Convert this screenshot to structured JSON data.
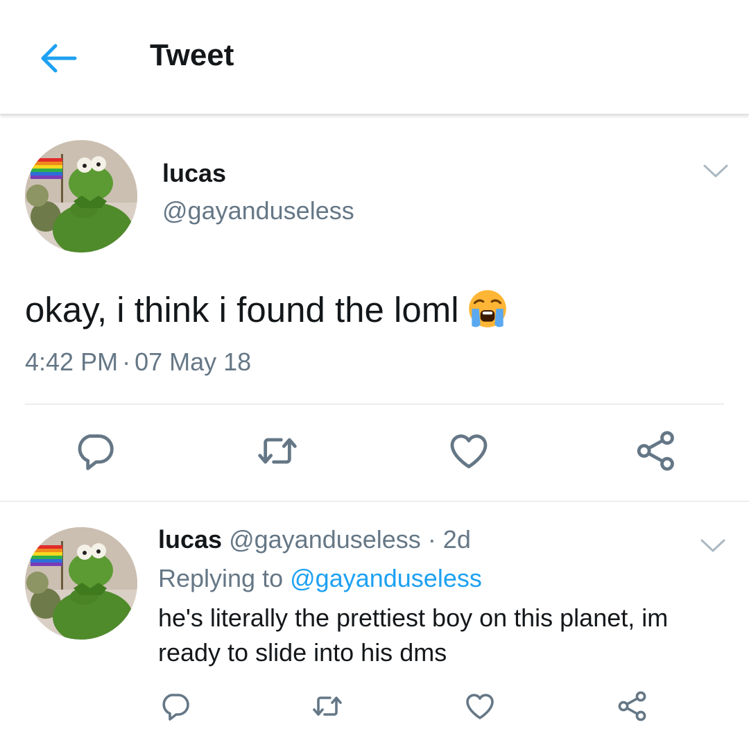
{
  "header": {
    "title": "Tweet",
    "back_icon": "arrow-left-icon",
    "accent_color": "#1da1f2"
  },
  "main_tweet": {
    "author_name": "lucas",
    "author_handle": "@gayanduseless",
    "text": "okay, i think i found the loml",
    "emoji": "loudly-crying-face",
    "time": "4:42 PM",
    "separator": "·",
    "date": "07 May 18",
    "actions": [
      "reply-icon",
      "retweet-icon",
      "like-icon",
      "share-icon"
    ]
  },
  "reply_tweet": {
    "author_name": "lucas",
    "author_handle": "@gayanduseless",
    "age": "· 2d",
    "replying_prefix": "Replying to",
    "replying_to": "@gayanduseless",
    "text": "he's literally the prettiest boy on this planet, im ready to slide into his dms",
    "actions": [
      "reply-icon",
      "retweet-icon",
      "like-icon",
      "share-icon"
    ]
  },
  "colors": {
    "text_primary": "#14171a",
    "text_secondary": "#657786",
    "divider": "#d8dde1",
    "icon_gray": "#657786"
  }
}
